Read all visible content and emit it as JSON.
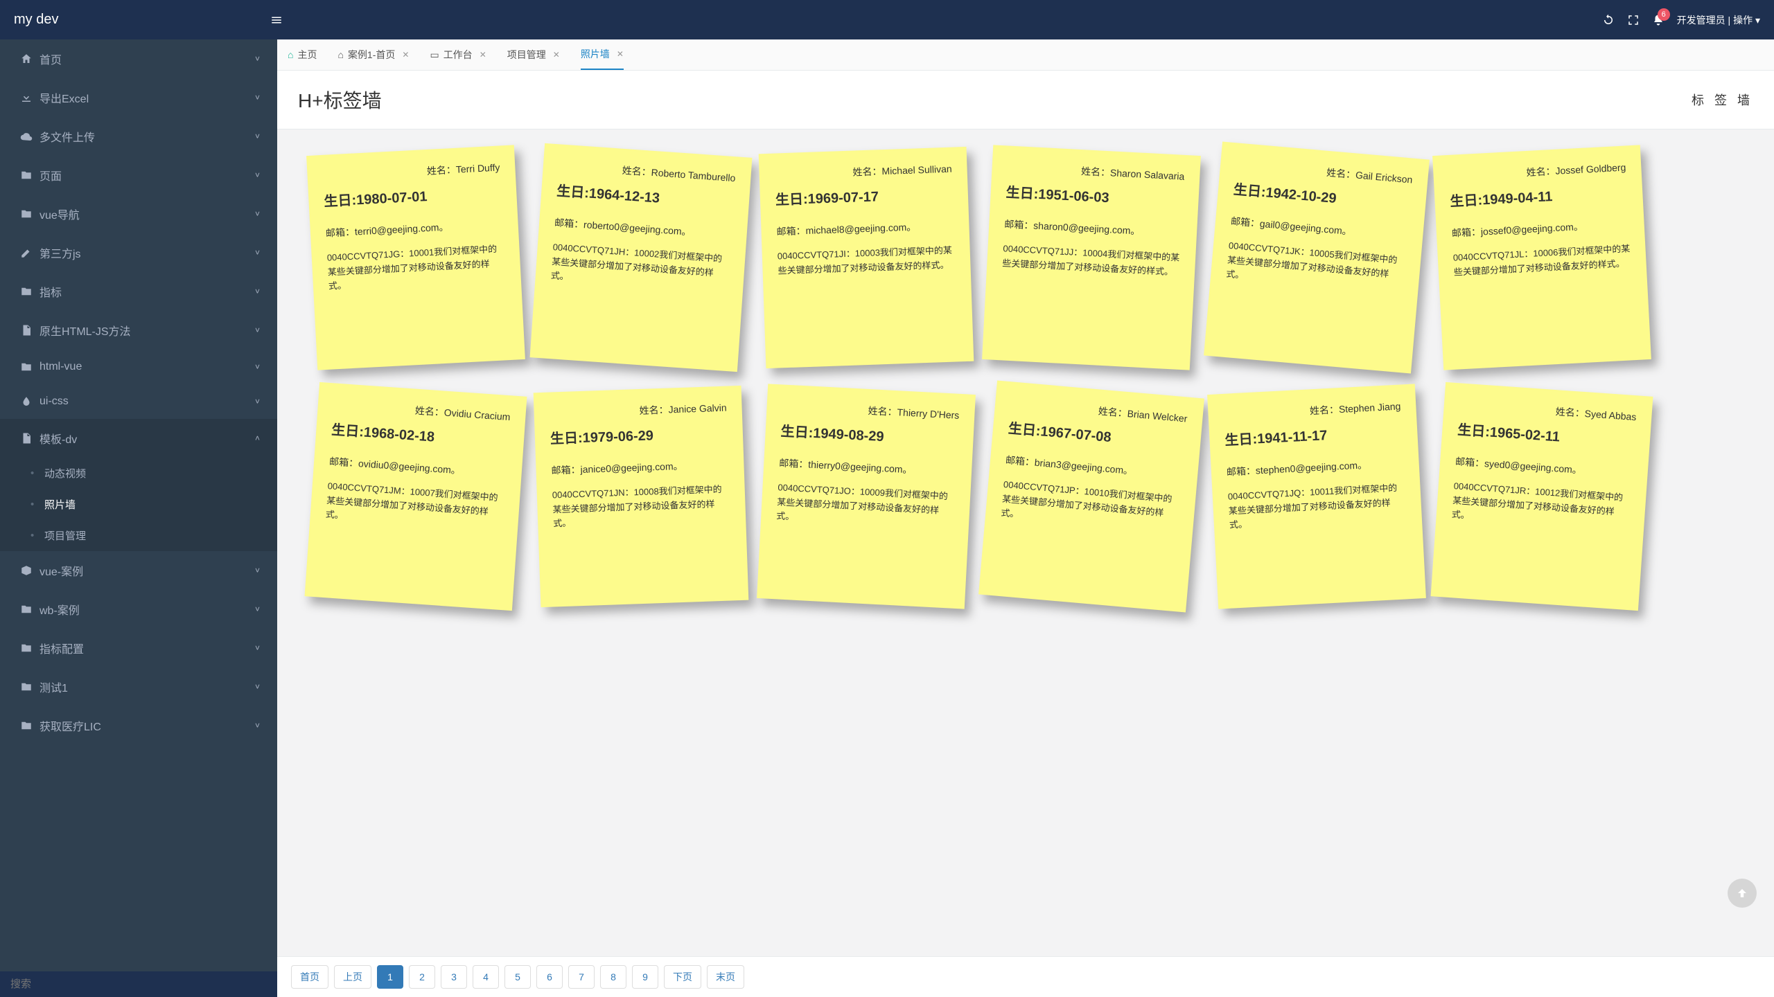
{
  "header": {
    "logo": "my dev",
    "user": "开发管理员",
    "action_label": "操作",
    "notification_count": "6"
  },
  "sidebar": {
    "items": [
      {
        "icon": "home",
        "label": "首页"
      },
      {
        "icon": "download",
        "label": "导出Excel"
      },
      {
        "icon": "cloud",
        "label": "多文件上传"
      },
      {
        "icon": "folder",
        "label": "页面"
      },
      {
        "icon": "folder",
        "label": "vue导航"
      },
      {
        "icon": "pencil",
        "label": "第三方js"
      },
      {
        "icon": "folder",
        "label": "指标"
      },
      {
        "icon": "doc",
        "label": "原生HTML-JS方法"
      },
      {
        "icon": "folder",
        "label": "html-vue"
      },
      {
        "icon": "drop",
        "label": "ui-css"
      },
      {
        "icon": "doc",
        "label": "模板-dv",
        "expanded": true,
        "children": [
          {
            "label": "动态视频"
          },
          {
            "label": "照片墙",
            "selected": true
          },
          {
            "label": "项目管理"
          }
        ]
      },
      {
        "icon": "box",
        "label": "vue-案例"
      },
      {
        "icon": "folder",
        "label": "wb-案例"
      },
      {
        "icon": "folder",
        "label": "指标配置"
      },
      {
        "icon": "folder",
        "label": "测试1"
      },
      {
        "icon": "folder",
        "label": "获取医疗LIC"
      }
    ],
    "search_placeholder": "搜索"
  },
  "tabs": [
    {
      "label": "主页",
      "icon": "home-color"
    },
    {
      "label": "案例1-首页",
      "icon": "home",
      "closable": true
    },
    {
      "label": "工作台",
      "icon": "id",
      "closable": true
    },
    {
      "label": "项目管理",
      "closable": true
    },
    {
      "label": "照片墙",
      "closable": true,
      "active": true
    }
  ],
  "page": {
    "title": "H+标签墙",
    "right_title": "标 签 墙"
  },
  "notes_labels": {
    "name_prefix": "姓名：",
    "bday_prefix": "生日:",
    "email_prefix": "邮箱："
  },
  "notes": [
    {
      "name": "Terri Duffy",
      "bday": "1980-07-01",
      "email": "terri0@geejing.com。",
      "desc": "0040CCVTQ71JG：10001我们对框架中的某些关键部分增加了对移动设备友好的样式。",
      "tilt": 1
    },
    {
      "name": "Roberto Tamburello",
      "bday": "1964-12-13",
      "email": "roberto0@geejing.com。",
      "desc": "0040CCVTQ71JH：10002我们对框架中的某些关键部分增加了对移动设备友好的样式。",
      "tilt": 2
    },
    {
      "name": "Michael Sullivan",
      "bday": "1969-07-17",
      "email": "michael8@geejing.com。",
      "desc": "0040CCVTQ71JI：10003我们对框架中的某些关键部分增加了对移动设备友好的样式。",
      "tilt": 3
    },
    {
      "name": "Sharon Salavaria",
      "bday": "1951-06-03",
      "email": "sharon0@geejing.com。",
      "desc": "0040CCVTQ71JJ：10004我们对框架中的某些关键部分增加了对移动设备友好的样式。",
      "tilt": 4
    },
    {
      "name": "Gail Erickson",
      "bday": "1942-10-29",
      "email": "gail0@geejing.com。",
      "desc": "0040CCVTQ71JK：10005我们对框架中的某些关键部分增加了对移动设备友好的样式。",
      "tilt": 5
    },
    {
      "name": "Jossef Goldberg",
      "bday": "1949-04-11",
      "email": "jossef0@geejing.com。",
      "desc": "0040CCVTQ71JL：10006我们对框架中的某些关键部分增加了对移动设备友好的样式。",
      "tilt": 1
    },
    {
      "name": "Ovidiu Cracium",
      "bday": "1968-02-18",
      "email": "ovidiu0@geejing.com。",
      "desc": "0040CCVTQ71JM：10007我们对框架中的某些关键部分增加了对移动设备友好的样式。",
      "tilt": 2
    },
    {
      "name": "Janice Galvin",
      "bday": "1979-06-29",
      "email": "janice0@geejing.com。",
      "desc": "0040CCVTQ71JN：10008我们对框架中的某些关键部分增加了对移动设备友好的样式。",
      "tilt": 3
    },
    {
      "name": "Thierry D'Hers",
      "bday": "1949-08-29",
      "email": "thierry0@geejing.com。",
      "desc": "0040CCVTQ71JO：10009我们对框架中的某些关键部分增加了对移动设备友好的样式。",
      "tilt": 4
    },
    {
      "name": "Brian Welcker",
      "bday": "1967-07-08",
      "email": "brian3@geejing.com。",
      "desc": "0040CCVTQ71JP：10010我们对框架中的某些关键部分增加了对移动设备友好的样式。",
      "tilt": 5
    },
    {
      "name": "Stephen Jiang",
      "bday": "1941-11-17",
      "email": "stephen0@geejing.com。",
      "desc": "0040CCVTQ71JQ：10011我们对框架中的某些关键部分增加了对移动设备友好的样式。",
      "tilt": 1
    },
    {
      "name": "Syed Abbas",
      "bday": "1965-02-11",
      "email": "syed0@geejing.com。",
      "desc": "0040CCVTQ71JR：10012我们对框架中的某些关键部分增加了对移动设备友好的样式。",
      "tilt": 2
    }
  ],
  "pagination": {
    "first": "首页",
    "prev": "上页",
    "next": "下页",
    "last": "末页",
    "pages": [
      "1",
      "2",
      "3",
      "4",
      "5",
      "6",
      "7",
      "8",
      "9"
    ],
    "active": "1"
  }
}
